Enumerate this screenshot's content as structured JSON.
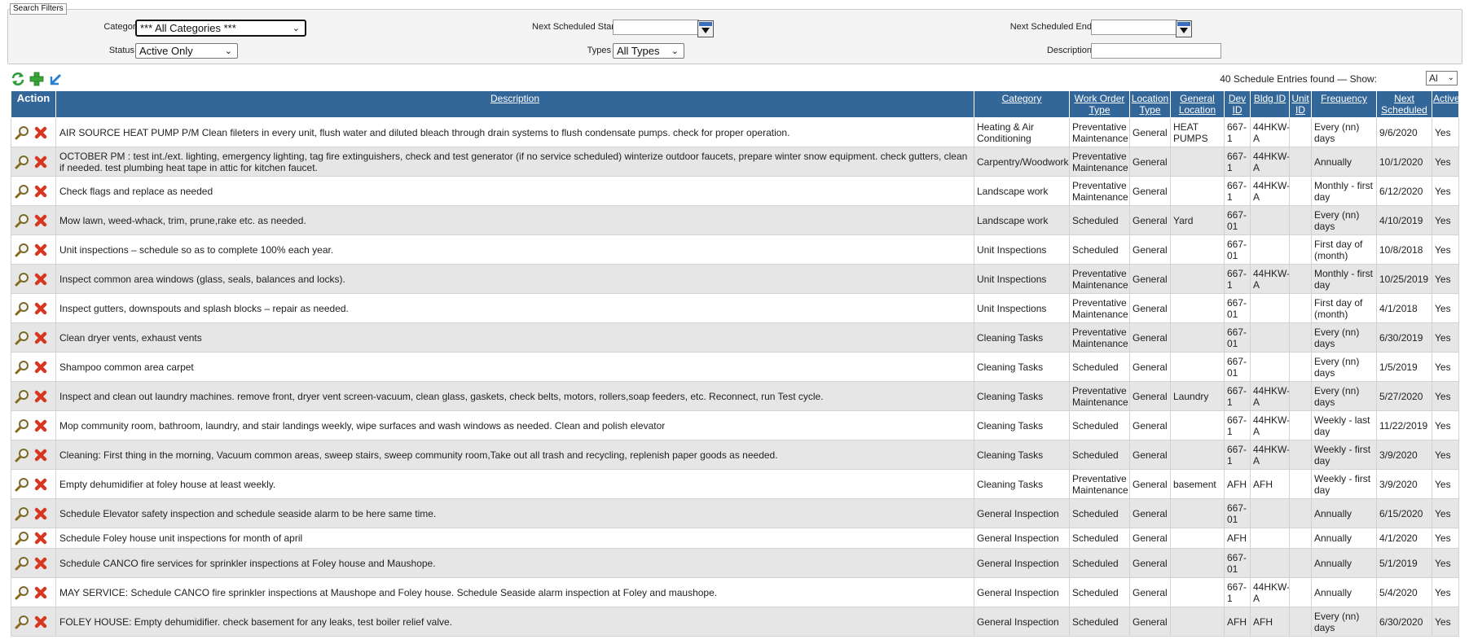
{
  "filters": {
    "legend": "Search Filters",
    "category_label": "Category",
    "category_value": "*** All Categories ***",
    "status_label": "Status",
    "status_value": "Active Only",
    "next_start_label": "Next Scheduled Start",
    "types_label": "Types",
    "types_value": "All Types",
    "next_end_label": "Next Scheduled End",
    "description_label": "Description"
  },
  "toolbar": {
    "icons": [
      "refresh-icon",
      "add-icon",
      "export-icon"
    ],
    "found_text": "40 Schedule Entries found  — Show:",
    "show_value": "Al"
  },
  "colors": {
    "header_bg": "#336699",
    "row_alt": "#e6e6e6",
    "delete_red": "#d9361f"
  },
  "table": {
    "headers": {
      "action": "Action",
      "description": "Description",
      "category": "Category",
      "wo_type_1": "Work Order",
      "wo_type_2": "Type",
      "loc_type_1": "Location",
      "loc_type_2": "Type",
      "gen_loc_1": "General",
      "gen_loc_2": "Location",
      "dev_id_1": "Dev",
      "dev_id_2": "ID",
      "bldg_id": "Bldg ID",
      "unit_id_1": "Unit",
      "unit_id_2": "ID",
      "frequency": "Frequency",
      "next_sched_1": "Next",
      "next_sched_2": "Scheduled",
      "active": "Active"
    },
    "rows": [
      {
        "description": "AIR SOURCE HEAT PUMP P/M Clean fileters in every unit, flush water and diluted bleach through drain systems to flush condensate pumps. check for proper operation.",
        "category": "Heating & Air Conditioning",
        "wo_type": "Preventative Maintenance",
        "loc_type": "General",
        "gen_loc": "HEAT PUMPS",
        "dev_id": "667-1",
        "bldg_id": "44HKW-A",
        "unit_id": "",
        "frequency": "Every (nn) days",
        "next": "9/6/2020",
        "active": "Yes"
      },
      {
        "description": "OCTOBER PM : test int./ext. lighting, emergency lighting, tag fire extinguishers, check and test generator (if no service scheduled) winterize outdoor faucets, prepare winter snow equipment. check gutters, clean if needed. test plumbing heat tape in attic for kitchen faucet.",
        "category": "Carpentry/Woodwork",
        "wo_type": "Preventative Maintenance",
        "loc_type": "General",
        "gen_loc": "",
        "dev_id": "667-1",
        "bldg_id": "44HKW-A",
        "unit_id": "",
        "frequency": "Annually",
        "next": "10/1/2020",
        "active": "Yes"
      },
      {
        "description": "Check flags and replace as needed",
        "category": "Landscape work",
        "wo_type": "Preventative Maintenance",
        "loc_type": "General",
        "gen_loc": "",
        "dev_id": "667-1",
        "bldg_id": "44HKW-A",
        "unit_id": "",
        "frequency": "Monthly - first day",
        "next": "6/12/2020",
        "active": "Yes"
      },
      {
        "description": "Mow lawn, weed-whack, trim, prune,rake etc. as needed.",
        "category": "Landscape work",
        "wo_type": "Scheduled",
        "loc_type": "General",
        "gen_loc": "Yard",
        "dev_id": "667-01",
        "bldg_id": "",
        "unit_id": "",
        "frequency": "Every (nn) days",
        "next": "4/10/2019",
        "active": "Yes"
      },
      {
        "description": "Unit inspections – schedule so as to complete 100% each year.",
        "category": "Unit Inspections",
        "wo_type": "Scheduled",
        "loc_type": "General",
        "gen_loc": "",
        "dev_id": "667-01",
        "bldg_id": "",
        "unit_id": "",
        "frequency": "First day of (month)",
        "next": "10/8/2018",
        "active": "Yes"
      },
      {
        "description": "Inspect common area windows (glass, seals, balances and locks).",
        "category": "Unit Inspections",
        "wo_type": "Preventative Maintenance",
        "loc_type": "General",
        "gen_loc": "",
        "dev_id": "667-1",
        "bldg_id": "44HKW-A",
        "unit_id": "",
        "frequency": "Monthly - first day",
        "next": "10/25/2019",
        "active": "Yes"
      },
      {
        "description": "Inspect gutters, downspouts and splash blocks – repair as needed.",
        "category": "Unit Inspections",
        "wo_type": "Preventative Maintenance",
        "loc_type": "General",
        "gen_loc": "",
        "dev_id": "667-01",
        "bldg_id": "",
        "unit_id": "",
        "frequency": "First day of (month)",
        "next": "4/1/2018",
        "active": "Yes"
      },
      {
        "description": "Clean dryer vents, exhaust vents",
        "category": "Cleaning Tasks",
        "wo_type": "Preventative Maintenance",
        "loc_type": "General",
        "gen_loc": "",
        "dev_id": "667-01",
        "bldg_id": "",
        "unit_id": "",
        "frequency": "Every (nn) days",
        "next": "6/30/2019",
        "active": "Yes"
      },
      {
        "description": "Shampoo common area carpet",
        "category": "Cleaning Tasks",
        "wo_type": "Scheduled",
        "loc_type": "General",
        "gen_loc": "",
        "dev_id": "667-01",
        "bldg_id": "",
        "unit_id": "",
        "frequency": "Every (nn) days",
        "next": "1/5/2019",
        "active": "Yes"
      },
      {
        "description": "Inspect and clean out laundry machines. remove front, dryer vent screen-vacuum, clean glass, gaskets, check belts, motors, rollers,soap feeders, etc. Reconnect, run Test cycle.",
        "category": "Cleaning Tasks",
        "wo_type": "Preventative Maintenance",
        "loc_type": "General",
        "gen_loc": "Laundry",
        "dev_id": "667-1",
        "bldg_id": "44HKW-A",
        "unit_id": "",
        "frequency": "Every (nn) days",
        "next": "5/27/2020",
        "active": "Yes"
      },
      {
        "description": "Mop community room, bathroom, laundry, and stair landings weekly, wipe surfaces and wash windows as needed. Clean and polish elevator",
        "category": "Cleaning Tasks",
        "wo_type": "Scheduled",
        "loc_type": "General",
        "gen_loc": "",
        "dev_id": "667-1",
        "bldg_id": "44HKW-A",
        "unit_id": "",
        "frequency": "Weekly - last day",
        "next": "11/22/2019",
        "active": "Yes"
      },
      {
        "description": "Cleaning: First thing in the morning, Vacuum common areas, sweep stairs, sweep community room,Take out all trash and recycling, replenish paper goods as needed.",
        "category": "Cleaning Tasks",
        "wo_type": "Scheduled",
        "loc_type": "General",
        "gen_loc": "",
        "dev_id": "667-1",
        "bldg_id": "44HKW-A",
        "unit_id": "",
        "frequency": "Weekly - first day",
        "next": "3/9/2020",
        "active": "Yes"
      },
      {
        "description": "Empty dehumidifier at foley house at least weekly.",
        "category": "Cleaning Tasks",
        "wo_type": "Preventative Maintenance",
        "loc_type": "General",
        "gen_loc": "basement",
        "dev_id": "AFH",
        "bldg_id": "AFH",
        "unit_id": "",
        "frequency": "Weekly - first day",
        "next": "3/9/2020",
        "active": "Yes"
      },
      {
        "description": "Schedule Elevator safety inspection and schedule seaside alarm to be here same time.",
        "category": "General Inspection",
        "wo_type": "Scheduled",
        "loc_type": "General",
        "gen_loc": "",
        "dev_id": "667-01",
        "bldg_id": "",
        "unit_id": "",
        "frequency": "Annually",
        "next": "6/15/2020",
        "active": "Yes"
      },
      {
        "description": "Schedule Foley house unit inspections for month of april",
        "category": "General Inspection",
        "wo_type": "Scheduled",
        "loc_type": "General",
        "gen_loc": "",
        "dev_id": "AFH",
        "bldg_id": "",
        "unit_id": "",
        "frequency": "Annually",
        "next": "4/1/2020",
        "active": "Yes"
      },
      {
        "description": "Schedule CANCO fire services for sprinkler inspections at Foley house and Maushope.",
        "category": "General Inspection",
        "wo_type": "Scheduled",
        "loc_type": "General",
        "gen_loc": "",
        "dev_id": "667-01",
        "bldg_id": "",
        "unit_id": "",
        "frequency": "Annually",
        "next": "5/1/2019",
        "active": "Yes"
      },
      {
        "description": "MAY SERVICE: Schedule CANCO fire sprinkler inspections at Maushope and Foley house. Schedule Seaside alarm inspection at Foley and maushope.",
        "category": "General Inspection",
        "wo_type": "Scheduled",
        "loc_type": "General",
        "gen_loc": "",
        "dev_id": "667-1",
        "bldg_id": "44HKW-A",
        "unit_id": "",
        "frequency": "Annually",
        "next": "5/4/2020",
        "active": "Yes"
      },
      {
        "description": "FOLEY HOUSE: Empty dehumidifier. check basement for any leaks, test boiler relief valve.",
        "category": "General Inspection",
        "wo_type": "Scheduled",
        "loc_type": "General",
        "gen_loc": "",
        "dev_id": "AFH",
        "bldg_id": "AFH",
        "unit_id": "",
        "frequency": "Every (nn) days",
        "next": "6/30/2020",
        "active": "Yes"
      }
    ]
  }
}
